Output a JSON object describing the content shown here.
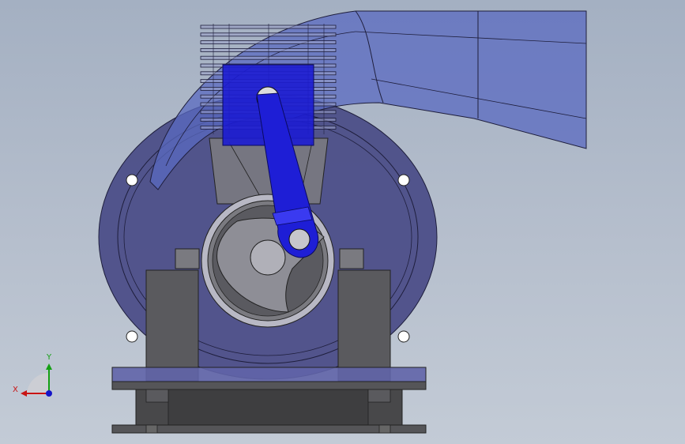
{
  "viewport": {
    "title": "",
    "background_top": "#a4b0c2",
    "background_bottom": "#c3cbd6"
  },
  "model": {
    "parts": [
      "crankcase",
      "intake-duct",
      "cylinder-fins",
      "piston",
      "connecting-rod",
      "crank-disc",
      "base-plate",
      "mount-blocks",
      "bolt-holes"
    ],
    "colors": {
      "transparent_blue": "#4a58b8",
      "solid_blue": "#1a1ad6",
      "dark_gray": "#555555",
      "light_gray": "#8a8a8a",
      "outline": "#222233"
    }
  },
  "triad": {
    "x_label": "X",
    "y_label": "Y",
    "x_color": "#c81414",
    "y_color": "#14a014",
    "z_color": "#1414c8"
  }
}
